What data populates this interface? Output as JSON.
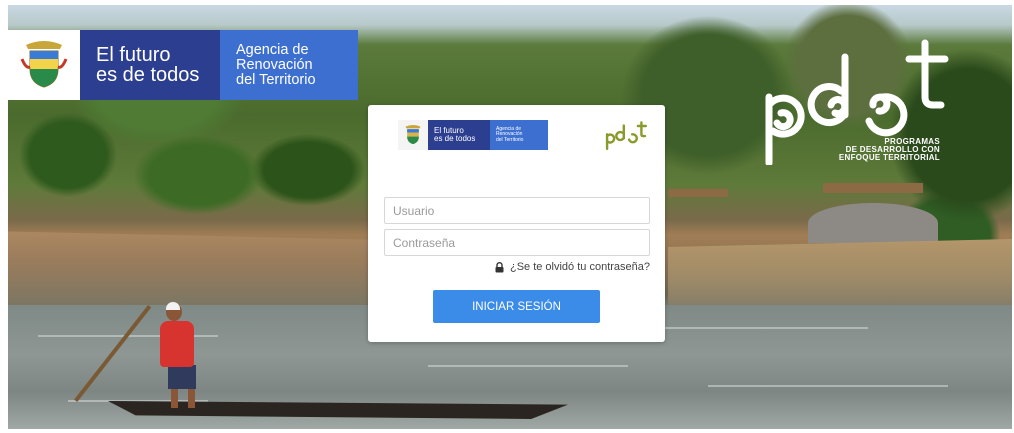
{
  "brand": {
    "line1": "El futuro",
    "line2": "es de todos",
    "agency_line1": "Agencia de",
    "agency_line2": "Renovación",
    "agency_line3": "del Territorio"
  },
  "pdet": {
    "wordmark": "pdet",
    "tagline_line1": "PROGRAMAS",
    "tagline_line2": "DE DESARROLLO CON",
    "tagline_line3": "ENFOQUE TERRITORIAL"
  },
  "login": {
    "username_placeholder": "Usuario",
    "password_placeholder": "Contraseña",
    "forgot_label": "¿Se te olvidó tu contraseña?",
    "submit_label": "INICIAR SESIÓN"
  },
  "colors": {
    "brand_dark": "#2c3e8f",
    "brand_light": "#3d6fd0",
    "button": "#3b8be9",
    "pdet_green": "#8a9a2b"
  },
  "icons": {
    "shield": "colombia-coat-of-arms-icon",
    "lock": "lock-icon"
  }
}
